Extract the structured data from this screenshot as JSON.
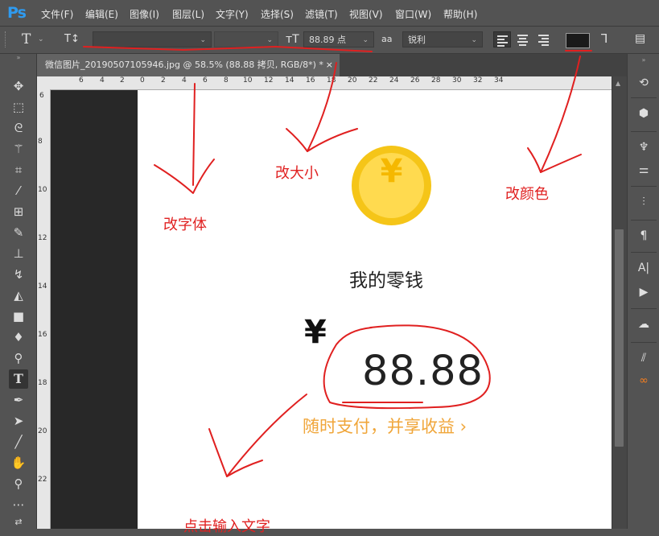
{
  "app": {
    "logo": "Ps"
  },
  "menu": [
    "文件(F)",
    "编辑(E)",
    "图像(I)",
    "图层(L)",
    "文字(Y)",
    "选择(S)",
    "滤镜(T)",
    "视图(V)",
    "窗口(W)",
    "帮助(H)"
  ],
  "options": {
    "tool_icon": "T",
    "orientation_icon": "T↕",
    "font_family_value": "",
    "font_size_value": "88.89 点",
    "antialias_icon": "aa",
    "antialias_value": "锐利",
    "text_color": "#1a1a1a"
  },
  "document": {
    "tab_title": "微信图片_20190507105946.jpg @ 58.5% (88.88 拷贝, RGB/8*) *",
    "close": "×",
    "hruler_ticks": [
      "6",
      "4",
      "2",
      "0",
      "2",
      "4",
      "6",
      "8",
      "10",
      "12",
      "14",
      "16",
      "18",
      "20",
      "22",
      "24",
      "26",
      "28",
      "30",
      "32",
      "34"
    ],
    "vruler_ticks": [
      "6",
      "8",
      "10",
      "12",
      "14",
      "16",
      "18",
      "20",
      "22"
    ]
  },
  "content": {
    "coin_symbol": "¥",
    "title": "我的零钱",
    "currency": "¥",
    "amount": "88.88",
    "slogan": "随时支付，并享收益 ›"
  },
  "annotations": {
    "font": "改字体",
    "size": "改大小",
    "color": "改颜色",
    "input": "点击输入文字",
    "color_hex": "#e02020"
  }
}
